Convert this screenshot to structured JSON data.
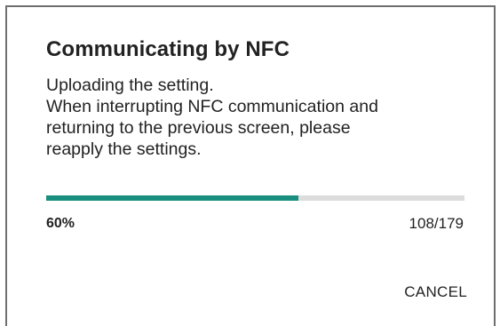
{
  "dialog": {
    "title": "Communicating by NFC",
    "message_lines": [
      "Uploading the setting.",
      "When interrupting NFC communication and",
      "returning to the previous screen, please",
      "reapply the settings."
    ],
    "progress": {
      "percent_label": "60%",
      "count_label": "108/179",
      "fraction": 0.6034,
      "fill_color": "#1a8f7f",
      "track_color": "#dcdcdc"
    },
    "cancel_label": "CANCEL"
  }
}
